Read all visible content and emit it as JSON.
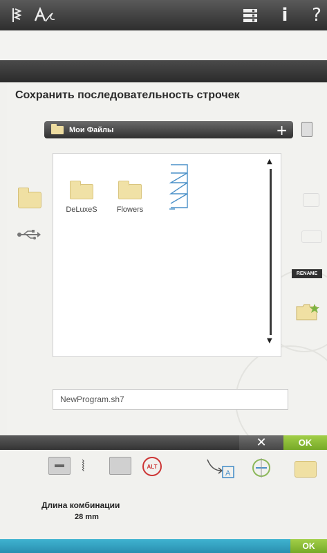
{
  "toolbar": {
    "icons": [
      "stitch-menu-icon",
      "font-icon",
      "file-manager-icon",
      "info-icon",
      "help-icon"
    ],
    "info_glyph": "i",
    "help_glyph": "?"
  },
  "dialog": {
    "title": "Сохранить последовательность строчек",
    "path_label": "Мои Файлы",
    "items": [
      {
        "name": "DeLuxeS",
        "type": "folder"
      },
      {
        "name": "Flowers",
        "type": "folder"
      },
      {
        "name": "",
        "type": "stitch-sequence-file"
      }
    ],
    "rename_label": "RENAME",
    "filename": "NewProgram.sh7"
  },
  "actions": {
    "cancel_glyph": "✕",
    "ok_label": "OK"
  },
  "icon_row": {
    "alt_label": "ALT"
  },
  "info": {
    "length_label": "Длина комбинации",
    "length_value": "28 mm"
  },
  "bottom": {
    "ok_label": "OK"
  },
  "colors": {
    "ok_green": "#8fc03a",
    "bottom_bar": "#36a6c5",
    "folder_yellow": "#f0e0a3",
    "dark_bar": "#3a3a3a"
  }
}
